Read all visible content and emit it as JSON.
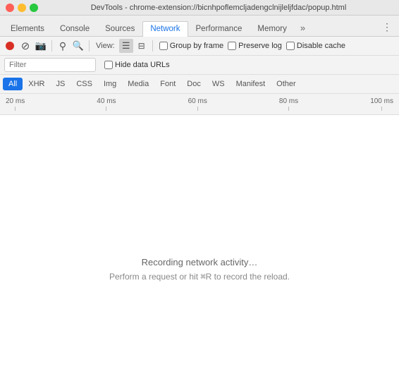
{
  "window": {
    "title": "DevTools - chrome-extension://bicnhpoflemcljadengclnijleljfdac/popup.html"
  },
  "nav": {
    "tabs": [
      {
        "id": "elements",
        "label": "Elements",
        "active": false
      },
      {
        "id": "console",
        "label": "Console",
        "active": false
      },
      {
        "id": "sources",
        "label": "Sources",
        "active": false
      },
      {
        "id": "network",
        "label": "Network",
        "active": true
      },
      {
        "id": "performance",
        "label": "Performance",
        "active": false
      },
      {
        "id": "memory",
        "label": "Memory",
        "active": false
      }
    ],
    "more_icon": "»",
    "menu_icon": "⋮"
  },
  "toolbar": {
    "record_icon": "●",
    "stop_icon": "⊘",
    "camera_icon": "📷",
    "filter_icon": "⚲",
    "search_icon": "🔍",
    "view_label": "View:",
    "list_view_icon": "☰",
    "waterfall_view_icon": "⊟",
    "group_by_frame_label": "Group by frame",
    "group_by_frame_checked": false,
    "preserve_log_label": "Preserve log",
    "preserve_log_checked": false,
    "disable_cache_label": "Disable cache",
    "disable_cache_checked": false
  },
  "filter_bar": {
    "filter_placeholder": "Filter",
    "hide_data_urls_label": "Hide data URLs",
    "hide_data_urls_checked": false
  },
  "type_filters": {
    "tabs": [
      {
        "id": "all",
        "label": "All",
        "active": true
      },
      {
        "id": "xhr",
        "label": "XHR",
        "active": false
      },
      {
        "id": "js",
        "label": "JS",
        "active": false
      },
      {
        "id": "css",
        "label": "CSS",
        "active": false
      },
      {
        "id": "img",
        "label": "Img",
        "active": false
      },
      {
        "id": "media",
        "label": "Media",
        "active": false
      },
      {
        "id": "font",
        "label": "Font",
        "active": false
      },
      {
        "id": "doc",
        "label": "Doc",
        "active": false
      },
      {
        "id": "ws",
        "label": "WS",
        "active": false
      },
      {
        "id": "manifest",
        "label": "Manifest",
        "active": false
      },
      {
        "id": "other",
        "label": "Other",
        "active": false
      }
    ]
  },
  "timeline": {
    "ticks": [
      "20 ms",
      "40 ms",
      "60 ms",
      "80 ms",
      "100 ms"
    ]
  },
  "main": {
    "recording_line1": "Recording network activity…",
    "recording_line2_before": "Perform a request or hit ",
    "recording_cmd_symbol": "⌘",
    "recording_key": "R",
    "recording_line2_after": " to record the reload."
  }
}
